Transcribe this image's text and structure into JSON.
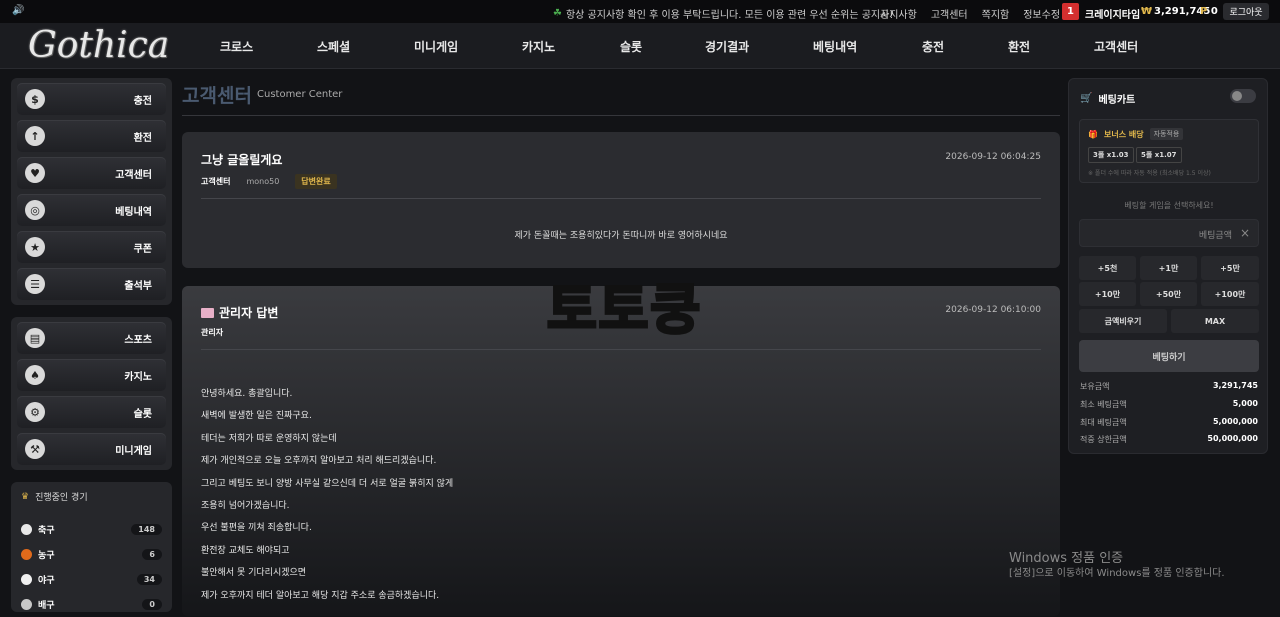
{
  "topbar": {
    "volume_icon": "speaker-icon",
    "notice_icon": "leaf-icon",
    "notice": "항상 공지사항 확인 후 이용 부탁드립니다. 모든 이용 관련 우선 순위는 공지사!",
    "links": [
      "공지사항",
      "고객센터",
      "쪽지함",
      "정보수정"
    ],
    "level": "1",
    "username": "크레이지타임",
    "money_symbol": "₩",
    "money": "3,291,745",
    "points_symbol": "P",
    "points": "0",
    "logout": "로그아웃"
  },
  "nav": {
    "logo": "Gothica",
    "items": [
      "크로스",
      "스페셜",
      "미니게임",
      "카지노",
      "슬롯",
      "경기결과",
      "베팅내역",
      "충전",
      "환전",
      "고객센터"
    ]
  },
  "sidebar": {
    "menu1": [
      {
        "icon": "dollar-icon",
        "label": "충전"
      },
      {
        "icon": "withdraw-icon",
        "label": "환전"
      },
      {
        "icon": "handshake-icon",
        "label": "고객센터"
      },
      {
        "icon": "target-icon",
        "label": "베팅내역"
      },
      {
        "icon": "trophy-icon",
        "label": "쿠폰"
      },
      {
        "icon": "clipboard-icon",
        "label": "출석부"
      }
    ],
    "menu2": [
      {
        "icon": "ticket-icon",
        "label": "스포츠"
      },
      {
        "icon": "card-icon",
        "label": "카지노"
      },
      {
        "icon": "gear-icon",
        "label": "슬롯"
      },
      {
        "icon": "joystick-icon",
        "label": "미니게임"
      }
    ],
    "live": {
      "title": "진행중인 경기",
      "items": [
        {
          "name": "축구",
          "count": "148",
          "color": "#e8e8e8"
        },
        {
          "name": "농구",
          "count": "6",
          "color": "#e06a1b"
        },
        {
          "name": "야구",
          "count": "34",
          "color": "#f0f0f0"
        },
        {
          "name": "배구",
          "count": "0",
          "color": "#d8d8d8"
        }
      ]
    }
  },
  "page": {
    "title": "고객센터",
    "subtitle": "Customer Center"
  },
  "question": {
    "title": "그냥 글올릴게요",
    "date": "2026-09-12 06:04:25",
    "category": "고객센터",
    "user": "mono50",
    "status": "답변완료",
    "body": "제가 돈꼴때는 조용히있다가 돈따니까 바로 영어하시네요"
  },
  "answer": {
    "title": "관리자 답변",
    "date": "2026-09-12 06:10:00",
    "author": "관리자",
    "lines": [
      "안녕하세요. 총괄입니다.",
      "새벽에 발생한 일은 진짜구요.",
      "테더는 저희가 따로 운영하지 않는데",
      "제가 개인적으로 오늘 오후까지 알아보고 처리 해드리겠습니다.",
      "그리고 베팅도 보니 양방 사무실 같으신데 더 서로 얼굴 붉히지 않게",
      "조용히 넘어가겠습니다.",
      "우선 불편을 끼쳐 죄송합니다.",
      "환전장 교체도 해야되고",
      "불안해서 못 기다리시겠으면",
      "제가 오후까지 테더 알아보고 해당 지갑 주소로 송금하겠습니다."
    ]
  },
  "overlay": {
    "watermark": "토토쿵"
  },
  "cart": {
    "title": "베팅카트",
    "bonus_title": "보너스 배당",
    "bonus_auto": "자동적용",
    "folds": [
      "3폴 x1.03",
      "5폴 x1.07"
    ],
    "bonus_note": "※ 폴더 수에 따라 자동 적용 (최소배당 1.5 이상)",
    "select_msg": "베팅할 게임을 선택하세요!",
    "amount_placeholder": "베팅금액",
    "quick": [
      "+5천",
      "+1만",
      "+5만",
      "+10만",
      "+50만",
      "+100만"
    ],
    "clear": "금액비우기",
    "max": "MAX",
    "bet_button": "베팅하기",
    "info": [
      {
        "k": "보유금액",
        "v": "3,291,745"
      },
      {
        "k": "최소 베팅금액",
        "v": "5,000"
      },
      {
        "k": "최대 베팅금액",
        "v": "5,000,000"
      },
      {
        "k": "적중 상한금액",
        "v": "50,000,000"
      }
    ]
  },
  "windows": {
    "line1": "Windows 정품 인증",
    "line2": "[설정]으로 이동하여 Windows를 정품 인증합니다."
  }
}
